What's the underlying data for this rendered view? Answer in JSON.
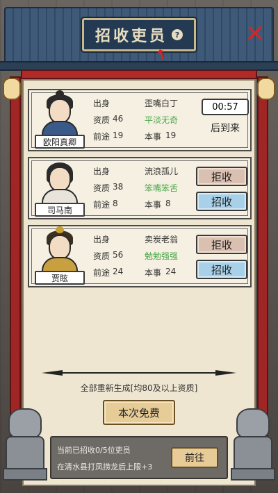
{
  "header": {
    "title": "招收吏员",
    "help_icon": "?",
    "close_icon": "✕"
  },
  "candidates": [
    {
      "name": "欧阳真卿",
      "origin_label": "出身",
      "origin": "歪嘴白丁",
      "aptitude_label": "资质",
      "aptitude": "46",
      "trait": "平淡无奇",
      "prospect_label": "前途",
      "prospect": "19",
      "skill_label": "本事",
      "skill": "19",
      "timer": "00:57",
      "later_label": "后到来"
    },
    {
      "name": "司马南",
      "origin_label": "出身",
      "origin": "流浪孤儿",
      "aptitude_label": "资质",
      "aptitude": "38",
      "trait": "笨嘴笨舌",
      "prospect_label": "前途",
      "prospect": "8",
      "skill_label": "本事",
      "skill": "8",
      "reject_label": "拒收",
      "recruit_label": "招收"
    },
    {
      "name": "贾眩",
      "origin_label": "出身",
      "origin": "卖炭老翁",
      "aptitude_label": "资质",
      "aptitude": "56",
      "trait": "勉勉强强",
      "prospect_label": "前途",
      "prospect": "24",
      "skill_label": "本事",
      "skill": "24",
      "reject_label": "拒收",
      "recruit_label": "招收"
    }
  ],
  "regen_text": "全部重新生成[均80及以上资质]",
  "free_button": "本次免费",
  "bottom": {
    "recruited_text": "当前已招收0/5位吏员",
    "hint_text": "在清水县打凤捞龙后上限+3",
    "goto_button": "前往"
  }
}
